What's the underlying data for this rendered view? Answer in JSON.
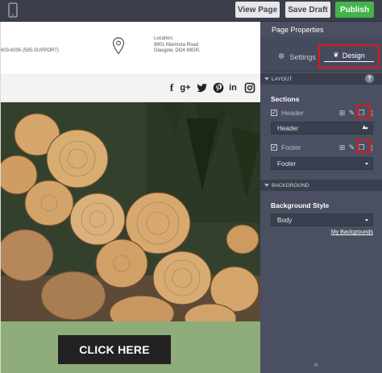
{
  "toolbar": {
    "device_icon": "mobile-device-icon",
    "view_page": "View Page",
    "save_draft": "Save Draft",
    "publish": "Publish"
  },
  "canvas": {
    "phone_partial": "603-6035 (585-SUPPORT)",
    "location": {
      "icon": "map-pin-icon",
      "label": "Location:",
      "line1": "8901 Marmora Road",
      "line2": "Glasgow, DO4 89GR."
    },
    "social_icons": [
      "f",
      "g+",
      "twitter",
      "pinterest",
      "in",
      "instagram"
    ],
    "hero_image": "stacked logs photo",
    "cta_label": "CLICK HERE"
  },
  "panel": {
    "title": "Page Properties",
    "tab_settings": "Settings",
    "tab_design": "Design",
    "layout_label": "LAYOUT",
    "sections_label": "Sections",
    "header": {
      "label": "Header",
      "select": "Header"
    },
    "footer": {
      "label": "Footer",
      "select": "Footer"
    },
    "background_label": "BACKGROUND",
    "bg_style_label": "Background Style",
    "bg_select": "Body",
    "my_backgrounds": "My Backgrounds",
    "collapse": "»"
  },
  "colors": {
    "publish": "#43b34a",
    "highlight": "#e0161d",
    "panel": "#4a5061",
    "cta_band": "#8fad7a"
  }
}
